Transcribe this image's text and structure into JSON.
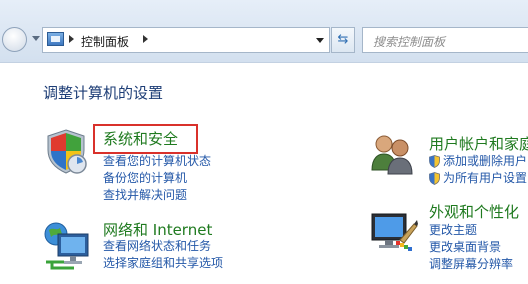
{
  "toolbar": {
    "address_text": "控制面板",
    "search_placeholder": "搜索控制面板"
  },
  "page_title": "调整计算机的设置",
  "categories": [
    {
      "heading": "系统和安全",
      "links": [
        "查看您的计算机状态",
        "备份您的计算机",
        "查找并解决问题"
      ]
    },
    {
      "heading": "网络和 Internet",
      "links": [
        "查看网络状态和任务",
        "选择家庭组和共享选项"
      ]
    },
    {
      "heading": "用户帐户和家庭",
      "links": [
        "添加或删除用户",
        "为所有用户设置"
      ]
    },
    {
      "heading": "外观和个性化",
      "links": [
        "更改主题",
        "更改桌面背景",
        "调整屏幕分辨率"
      ]
    }
  ],
  "colors": {
    "heading_green": "#1f7a1f",
    "link_blue": "#2458a8",
    "title_blue": "#1d3d76",
    "highlight_red": "#d9312b"
  },
  "icons": {
    "security": "shield-icon",
    "network": "network-icon",
    "users": "users-icon",
    "appearance": "appearance-icon",
    "uac": "uac-shield-icon"
  }
}
